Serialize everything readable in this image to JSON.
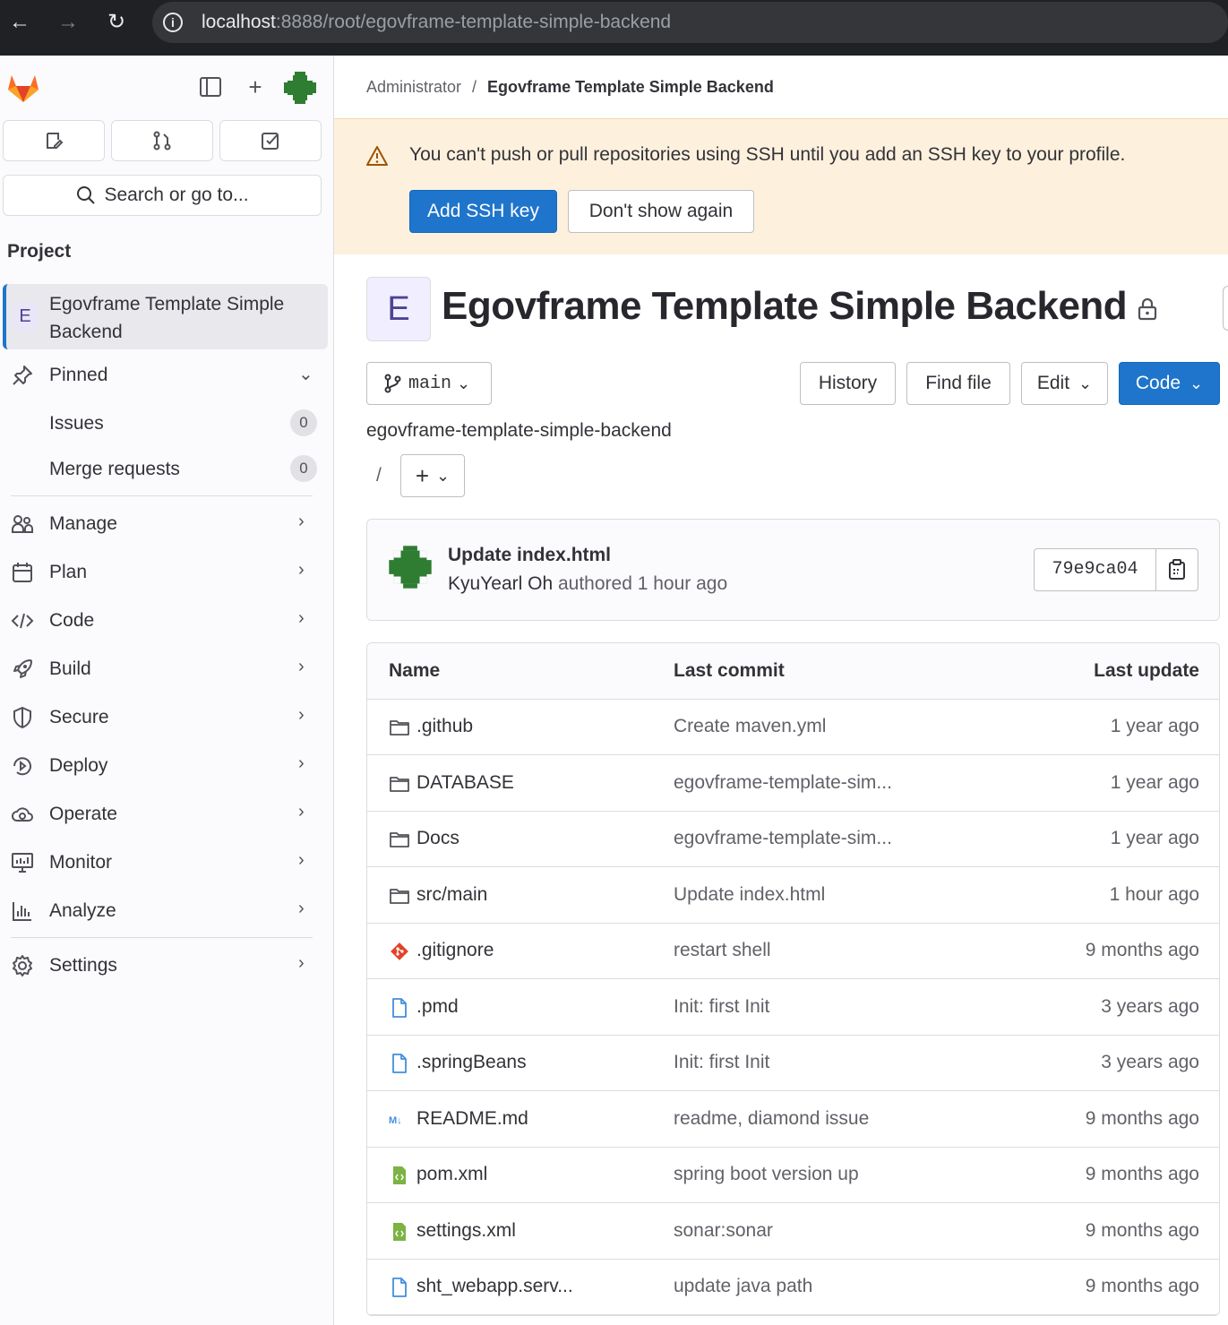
{
  "browser": {
    "url_host": "localhost",
    "url_rest": ":8888/root/egovframe-template-simple-backend"
  },
  "sidebar": {
    "search_label": "Search or go to...",
    "section_title": "Project",
    "project_avatar": "E",
    "project_name": "Egovframe Template Simple Backend",
    "pinned_label": "Pinned",
    "pinned_items": [
      {
        "label": "Issues",
        "count": "0"
      },
      {
        "label": "Merge requests",
        "count": "0"
      }
    ],
    "nav": [
      {
        "label": "Manage",
        "icon": "users-icon"
      },
      {
        "label": "Plan",
        "icon": "calendar-icon"
      },
      {
        "label": "Code",
        "icon": "code-icon"
      },
      {
        "label": "Build",
        "icon": "rocket-icon"
      },
      {
        "label": "Secure",
        "icon": "shield-icon"
      },
      {
        "label": "Deploy",
        "icon": "deployments-icon"
      },
      {
        "label": "Operate",
        "icon": "cloud-gear-icon"
      },
      {
        "label": "Monitor",
        "icon": "monitor-icon"
      },
      {
        "label": "Analyze",
        "icon": "chart-icon"
      }
    ],
    "settings_label": "Settings"
  },
  "breadcrumb": {
    "parent": "Administrator",
    "separator": "/",
    "current": "Egovframe Template Simple Backend"
  },
  "alert": {
    "message": "You can't push or pull repositories using SSH until you add an SSH key to your profile.",
    "primary_label": "Add SSH key",
    "secondary_label": "Don't show again"
  },
  "project": {
    "avatar_letter": "E",
    "title": "Egovframe Template Simple Backend"
  },
  "toolbar": {
    "branch": "main",
    "history_label": "History",
    "find_file_label": "Find file",
    "edit_label": "Edit",
    "code_label": "Code"
  },
  "path": {
    "root": "egovframe-template-simple-backend",
    "slash": "/"
  },
  "commit": {
    "title": "Update index.html",
    "author": "KyuYearl Oh",
    "meta": "authored 1 hour ago",
    "sha": "79e9ca04"
  },
  "table": {
    "headers": {
      "name": "Name",
      "last_commit": "Last commit",
      "last_update": "Last update"
    },
    "rows": [
      {
        "name": ".github",
        "type": "folder",
        "commit": "Create maven.yml",
        "updated": "1 year ago"
      },
      {
        "name": "DATABASE",
        "type": "folder",
        "commit": "egovframe-template-sim...",
        "updated": "1 year ago"
      },
      {
        "name": "Docs",
        "type": "folder",
        "commit": "egovframe-template-sim...",
        "updated": "1 year ago"
      },
      {
        "name": "src/main",
        "type": "folder",
        "commit": "Update index.html",
        "updated": "1 hour ago"
      },
      {
        "name": ".gitignore",
        "type": "git",
        "commit": "restart shell",
        "updated": "9 months ago"
      },
      {
        "name": ".pmd",
        "type": "file",
        "commit": "Init: first Init",
        "updated": "3 years ago"
      },
      {
        "name": ".springBeans",
        "type": "file",
        "commit": "Init: first Init",
        "updated": "3 years ago"
      },
      {
        "name": "README.md",
        "type": "markdown",
        "commit": "readme, diamond issue",
        "updated": "9 months ago"
      },
      {
        "name": "pom.xml",
        "type": "xml",
        "commit": "spring boot version up",
        "updated": "9 months ago"
      },
      {
        "name": "settings.xml",
        "type": "xml",
        "commit": "sonar:sonar",
        "updated": "9 months ago"
      },
      {
        "name": "sht_webapp.serv...",
        "type": "file",
        "commit": "update java path",
        "updated": "9 months ago"
      }
    ]
  },
  "colors": {
    "accent": "#1f75cb",
    "alert_bg": "#fdf1dd",
    "git_orange": "#e24329",
    "xml_green": "#7cb342",
    "file_blue": "#428fdc"
  }
}
